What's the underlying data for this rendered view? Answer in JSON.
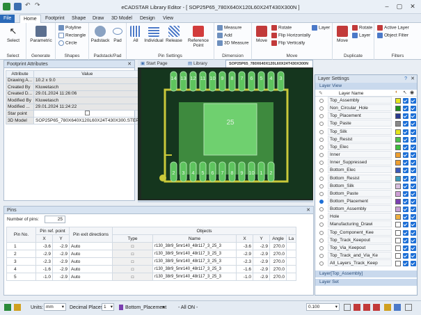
{
  "app": {
    "title": "eCADSTAR Library Editor - [ SOP25P65_780X640X120L60X24T430X300N ]"
  },
  "ribbon_tabs": [
    "File",
    "Home",
    "Footprint",
    "Shape",
    "Draw",
    "3D Model",
    "Design",
    "View"
  ],
  "ribbon": {
    "select": {
      "label": "Select",
      "group": "Select"
    },
    "generate": {
      "label": "Parametric",
      "group": "Generate"
    },
    "shapes": {
      "items": [
        "Polyline",
        "Rectangle",
        "Circle"
      ],
      "group": "Shapes"
    },
    "padstack": {
      "items": [
        "Padstack",
        "Pad"
      ],
      "group": "Padstack/Pad"
    },
    "pin_settings": {
      "items": [
        "All",
        "Individual",
        "Release",
        "Reference Point"
      ],
      "group": "Pin Settings"
    },
    "dimension": {
      "items": [
        "Measure",
        "Add",
        "3D Measure"
      ],
      "group": "Dimension"
    },
    "move": {
      "items": [
        "Move",
        "Rotate",
        "Flip Horizontally",
        "Flip Vertically",
        "Layer"
      ],
      "group": "Move"
    },
    "duplicate": {
      "items": [
        "Move",
        "Rotate",
        "Layer"
      ],
      "group": "Duplicate"
    },
    "filters": {
      "items": [
        "Active Layer",
        "Object Filter"
      ],
      "group": "Filters"
    }
  },
  "footprint_attributes": {
    "title": "Footprint Attributes",
    "headers": [
      "Attribute",
      "Value"
    ],
    "rows": [
      {
        "k": "Drawing A...",
        "v": "10.2 x 9.0"
      },
      {
        "k": "Created By",
        "v": "Kluwetasch"
      },
      {
        "k": "Created D...",
        "v": "29.01.2024 11:26:06"
      },
      {
        "k": "Modified By",
        "v": "Kluwetasch"
      },
      {
        "k": "Modified ...",
        "v": "29.01.2024 11:24:22"
      },
      {
        "k": "Star point",
        "v": ""
      },
      {
        "k": "3D Model",
        "v": "SOP25P65_780X640X120L60X24T430X300.STEP"
      }
    ]
  },
  "doc_tabs": [
    "Start Page",
    "Library",
    "SOP25P65_780X640X120L60X24T430X300N"
  ],
  "canvas": {
    "top_pins": [
      "14",
      "13",
      "12",
      "11",
      "10",
      "9",
      "8",
      "7",
      "6",
      "5",
      "4",
      "3"
    ],
    "bottom_pins": [
      "2",
      "3",
      "4",
      "5",
      "6",
      "7",
      "8",
      "9",
      "10",
      "1",
      "2"
    ],
    "center_label": "25"
  },
  "layer_settings": {
    "title": "Layer Settings",
    "view_label": "Layer View",
    "column": "Layer Name",
    "layers": [
      {
        "name": "Top_Assembly",
        "color": "#e6e61e",
        "sel": false
      },
      {
        "name": "Non_Circular_Hole",
        "color": "#1e8f1e",
        "sel": false
      },
      {
        "name": "Top_Placement",
        "color": "#2b3a8f",
        "sel": false
      },
      {
        "name": "Top_Paste",
        "color": "#8a8a8a",
        "sel": false
      },
      {
        "name": "Top_Silk",
        "color": "#e6e61e",
        "sel": false
      },
      {
        "name": "Top_Resist",
        "color": "#4cc24c",
        "sel": false
      },
      {
        "name": "Top_Elec",
        "color": "#3fbf3f",
        "sel": false
      },
      {
        "name": "Inner",
        "color": "#f0a030",
        "sel": false
      },
      {
        "name": "Inner_Suppressed",
        "color": "#f0a030",
        "sel": false
      },
      {
        "name": "Bottom_Elec",
        "color": "#3b5bbd",
        "sel": false
      },
      {
        "name": "Bottom_Resist",
        "color": "#3b9dbd",
        "sel": false
      },
      {
        "name": "Bottom_Silk",
        "color": "#d8c0e0",
        "sel": false
      },
      {
        "name": "Bottom_Paste",
        "color": "#d0a0d8",
        "sel": false
      },
      {
        "name": "Bottom_Placement",
        "color": "#7a3fb0",
        "sel": true
      },
      {
        "name": "Bottom_Assembly",
        "color": "#c8a0d8",
        "sel": false
      },
      {
        "name": "Hole",
        "color": "#f0b040",
        "sel": false
      },
      {
        "name": "Manufacturing_Drawi",
        "color": "#ffffff",
        "sel": false
      },
      {
        "name": "Top_Component_Kee",
        "color": "#ffffff",
        "sel": false
      },
      {
        "name": "Top_Track_Keepout",
        "color": "#ffffff",
        "sel": false
      },
      {
        "name": "Top_Via_Keepout",
        "color": "#ffffff",
        "sel": false
      },
      {
        "name": "Top_Track_and_Via_Ke",
        "color": "#ffffff",
        "sel": false
      },
      {
        "name": "All_Layers_Track_Keep",
        "color": "#ffffff",
        "sel": false
      }
    ],
    "footer1": "Layer[Top_Assembly]",
    "footer2": "Layer Set"
  },
  "pins": {
    "title": "Pins",
    "count_label": "Number of pins:",
    "count": "25",
    "headers": {
      "pin_no": "Pin No.",
      "ref_point": "Pin ref. point",
      "x": "X",
      "y": "Y",
      "exit": "Pin exit directions",
      "type": "Type",
      "objects": "Objects",
      "name": "Name",
      "ox": "X",
      "oy": "Y",
      "angle": "Angle",
      "la": "La"
    },
    "rows": [
      {
        "no": "1",
        "x": "-3.6",
        "y": "-2.9",
        "exit": "Auto",
        "name": "r130_38r9_5mr140_48r117_3_25_3",
        "ox": "-3.6",
        "oy": "-2.9",
        "angle": "270.0"
      },
      {
        "no": "2",
        "x": "-2.9",
        "y": "-2.9",
        "exit": "Auto",
        "name": "r130_38r9_5mr140_48r117_3_25_3",
        "ox": "-2.9",
        "oy": "-2.9",
        "angle": "270.0"
      },
      {
        "no": "3",
        "x": "-2.3",
        "y": "-2.9",
        "exit": "Auto",
        "name": "r130_38r9_5mr140_48r117_3_25_3",
        "ox": "-2.3",
        "oy": "-2.9",
        "angle": "270.0"
      },
      {
        "no": "4",
        "x": "-1.6",
        "y": "-2.9",
        "exit": "Auto",
        "name": "r130_38r9_5mr140_48r117_3_25_3",
        "ox": "-1.6",
        "oy": "-2.9",
        "angle": "270.0"
      },
      {
        "no": "5",
        "x": "-1.0",
        "y": "-2.9",
        "exit": "Auto",
        "name": "r130_38r9_5mr140_48r117_3_25_3",
        "ox": "-1.0",
        "oy": "-2.9",
        "angle": "270.0"
      }
    ]
  },
  "status": {
    "units_label": "Units:",
    "units": "mm",
    "decimal_label": "Decimal Places:",
    "decimal": "1",
    "layer": "Bottom_Placement",
    "all_on": "- All ON -",
    "zoom": "0.100"
  }
}
